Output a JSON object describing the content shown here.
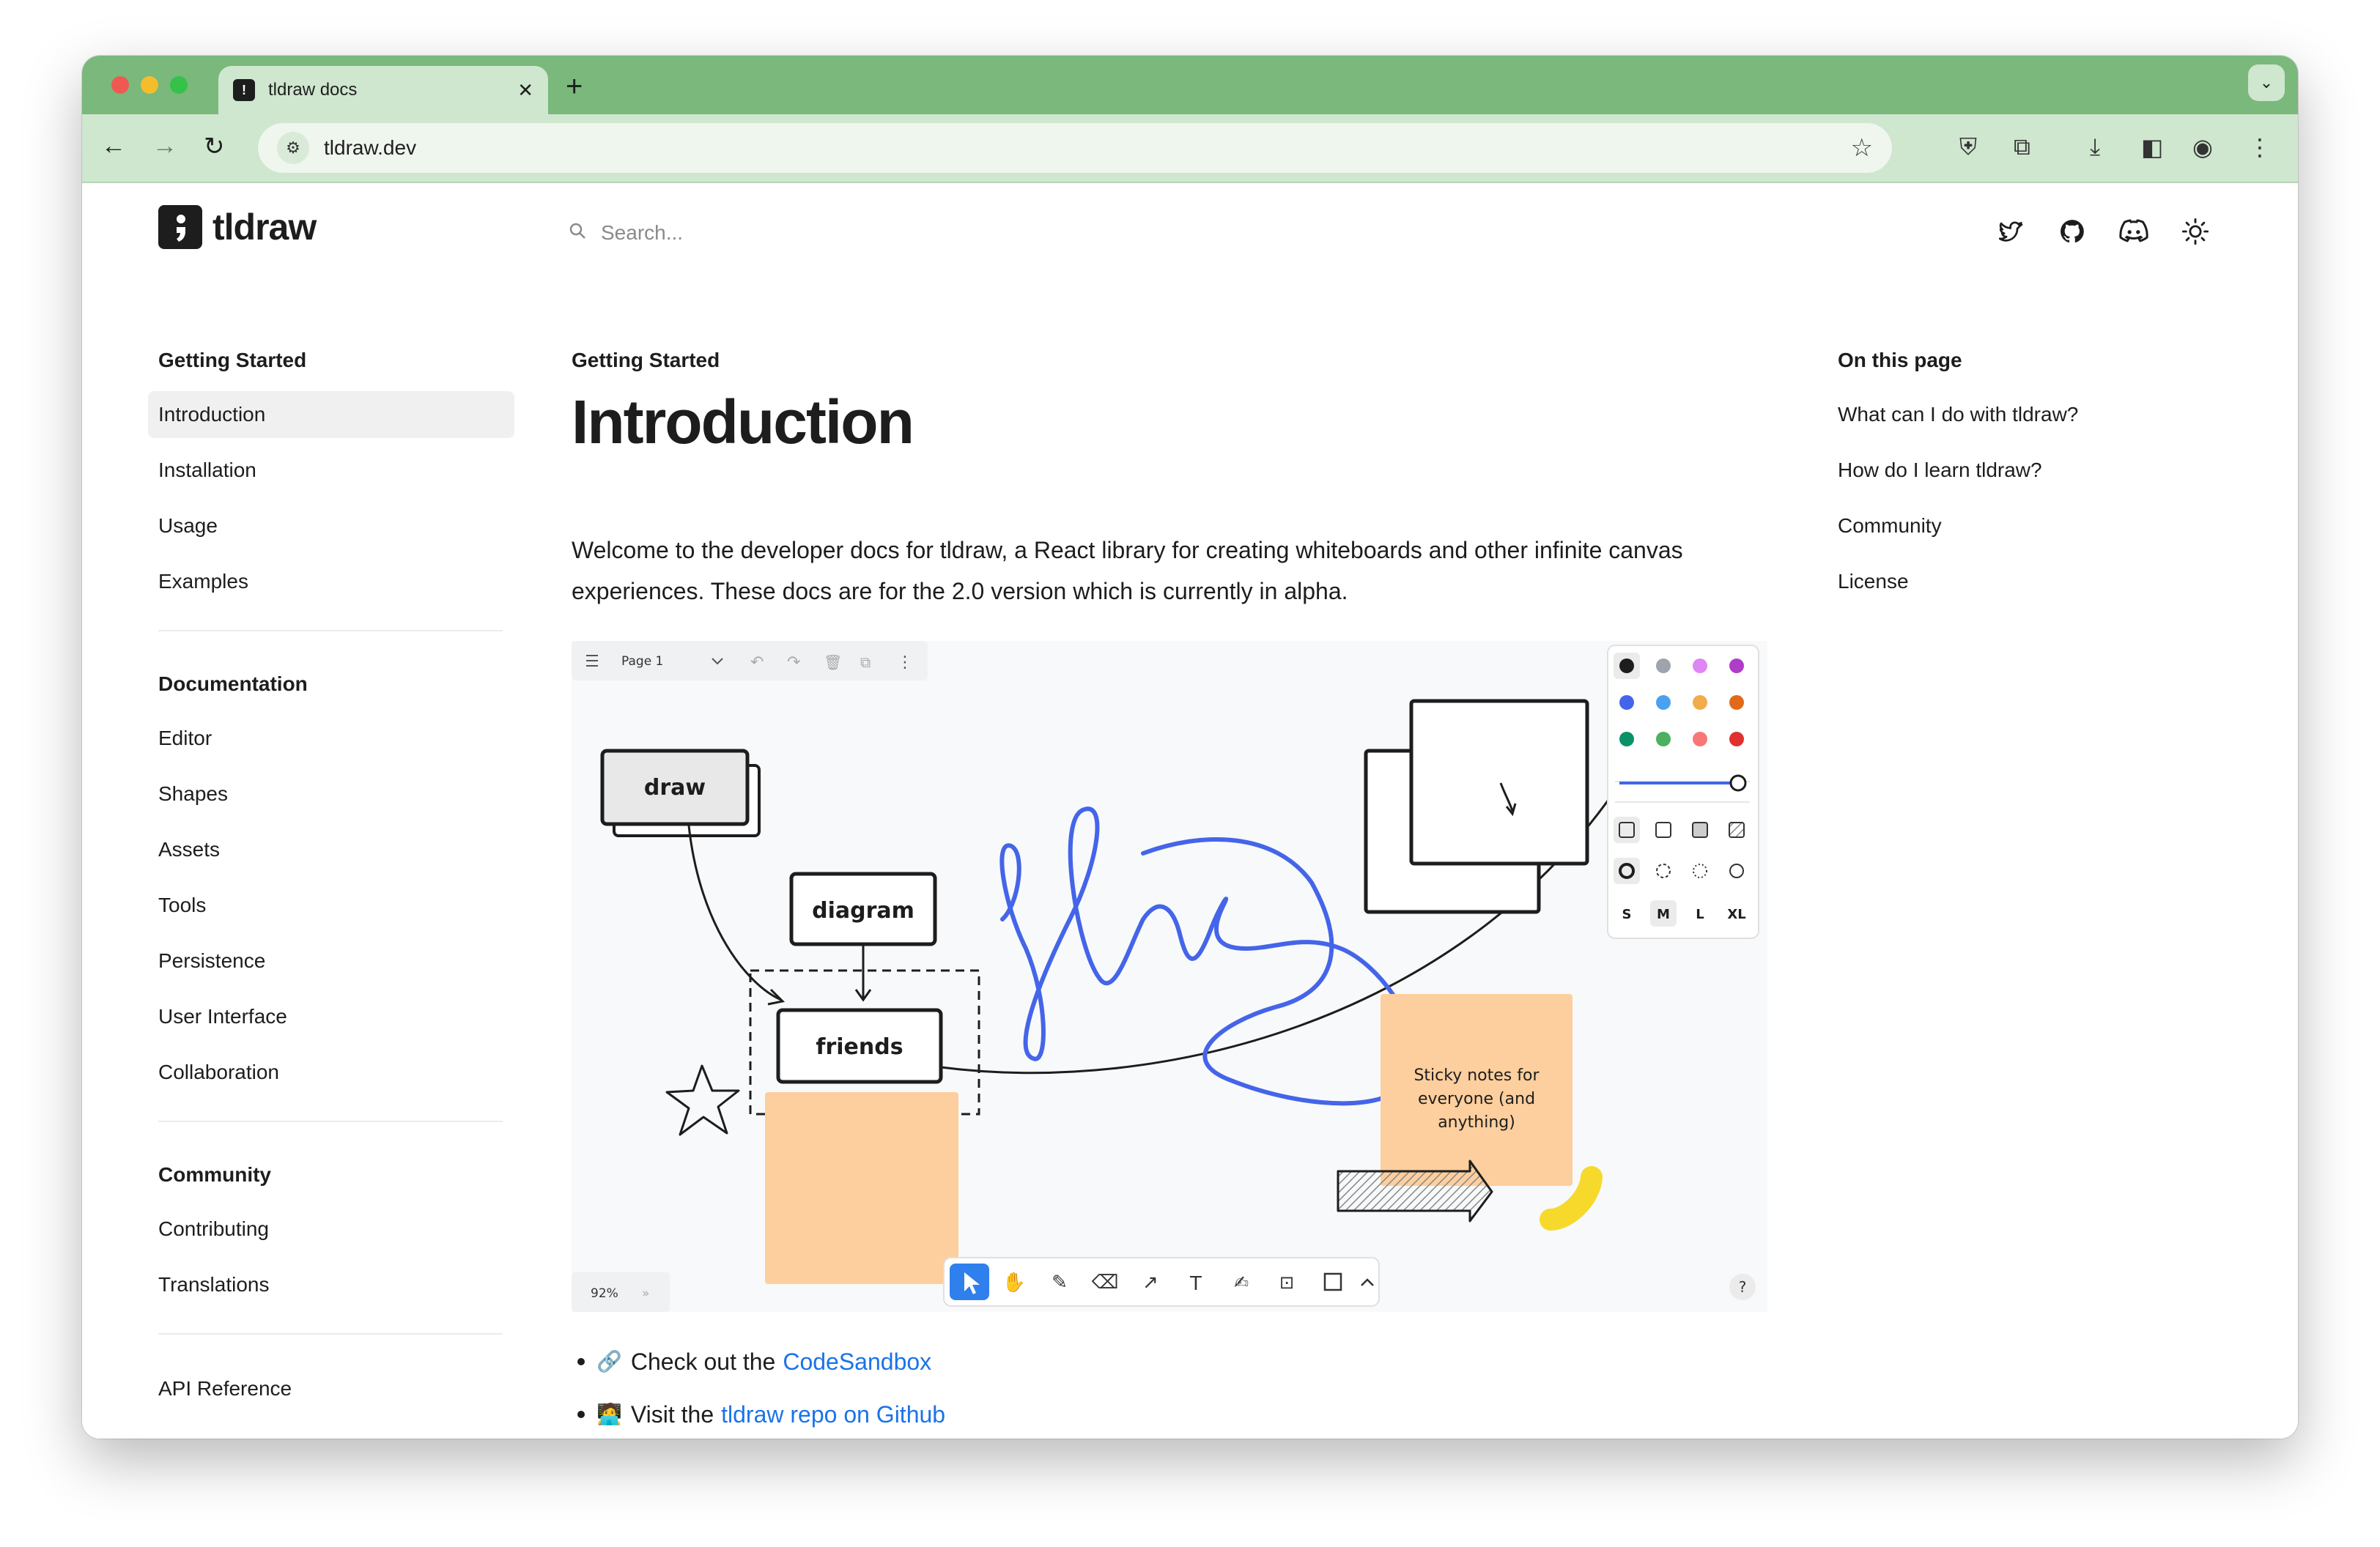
{
  "browser": {
    "tab_title": "tldraw docs",
    "url": "tldraw.dev"
  },
  "header": {
    "logo_text": "tldraw",
    "search_placeholder": "Search..."
  },
  "sidebar": {
    "groups": [
      {
        "heading": "Getting Started",
        "items": [
          "Introduction",
          "Installation",
          "Usage",
          "Examples"
        ]
      },
      {
        "heading": "Documentation",
        "items": [
          "Editor",
          "Shapes",
          "Assets",
          "Tools",
          "Persistence",
          "User Interface",
          "Collaboration"
        ]
      },
      {
        "heading": "Community",
        "items": [
          "Contributing",
          "Translations"
        ]
      }
    ],
    "api_reference": "API Reference",
    "active_item": "Introduction"
  },
  "main": {
    "eyebrow": "Getting Started",
    "title": "Introduction",
    "intro": "Welcome to the developer docs for tldraw, a React library for creating whiteboards and other infinite canvas experiences. These docs are for the 2.0 version which is currently in alpha.",
    "bullets": [
      {
        "emoji": "🔗",
        "text": "Check out the",
        "link": "CodeSandbox"
      },
      {
        "emoji": "🧑‍💻",
        "text": "Visit the",
        "link": "tldraw repo on Github"
      }
    ]
  },
  "canvas": {
    "page_name": "Page 1",
    "zoom": "92%",
    "shapes": [
      "draw",
      "diagram",
      "friends"
    ],
    "sticky_text": [
      "Sticky notes for",
      "everyone (and",
      "anything)"
    ],
    "sizes": [
      "S",
      "M",
      "L",
      "XL"
    ],
    "selected_size": "M",
    "help": "?",
    "palette": [
      "#1d1d1d",
      "#9ea4ab",
      "#e085f4",
      "#ae3ec9",
      "#4465e9",
      "#4ba1f1",
      "#f1ac4b",
      "#e16919",
      "#099268",
      "#4cb05e",
      "#f87777",
      "#e03131"
    ],
    "accent_color": "#2f80ed",
    "sticky_color": "#fdcf9e",
    "scribble_color": "#4465e9",
    "highlight_color": "#f7d92c"
  },
  "toc": {
    "heading": "On this page",
    "items": [
      "What can I do with tldraw?",
      "How do I learn tldraw?",
      "Community",
      "License"
    ]
  }
}
